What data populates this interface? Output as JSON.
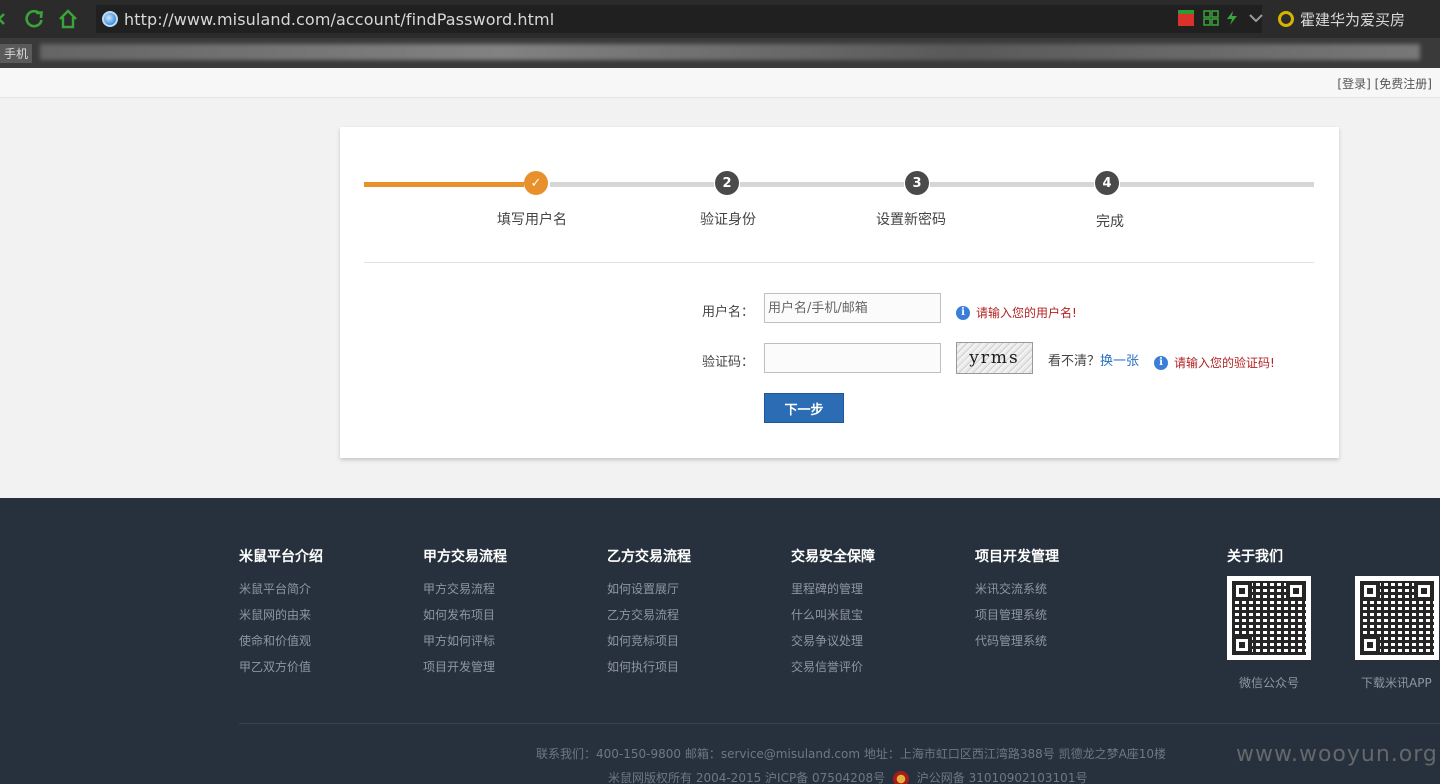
{
  "browser": {
    "url": "http://www.misuland.com/account/findPassword.html",
    "search_text": "霍建华为爱买房",
    "bookmark_label": "手机"
  },
  "topbar": {
    "login": "[登录]",
    "register": "[免费注册]"
  },
  "steps": [
    {
      "number": "✓",
      "label": "填写用户名",
      "state": "done"
    },
    {
      "number": "2",
      "label": "验证身份",
      "state": "pending"
    },
    {
      "number": "3",
      "label": "设置新密码",
      "state": "pending"
    },
    {
      "number": "4",
      "label": "完成",
      "state": "pending"
    }
  ],
  "form": {
    "username_label": "用户名：",
    "username_placeholder": "用户名/手机/邮箱",
    "username_value": "",
    "username_hint": "请输入您的用户名!",
    "captcha_label": "验证码：",
    "captcha_value": "",
    "captcha_text": "yrms",
    "refresh_prefix": "看不清？",
    "refresh_link": "换一张",
    "captcha_hint": "请输入您的验证码!",
    "next_button": "下一步"
  },
  "footer": {
    "columns": [
      {
        "title": "米鼠平台介绍",
        "items": [
          "米鼠平台简介",
          "米鼠网的由来",
          "使命和价值观",
          "甲乙双方价值"
        ]
      },
      {
        "title": "甲方交易流程",
        "items": [
          "甲方交易流程",
          "如何发布项目",
          "甲方如何评标",
          "项目开发管理"
        ]
      },
      {
        "title": "乙方交易流程",
        "items": [
          "如何设置展厅",
          "乙方交易流程",
          "如何竞标项目",
          "如何执行项目"
        ]
      },
      {
        "title": "交易安全保障",
        "items": [
          "里程碑的管理",
          "什么叫米鼠宝",
          "交易争议处理",
          "交易信誉评价"
        ]
      },
      {
        "title": "项目开发管理",
        "items": [
          "米讯交流系统",
          "项目管理系统",
          "代码管理系统"
        ]
      }
    ],
    "about_title": "关于我们",
    "qr1_caption": "微信公众号",
    "qr2_caption": "下载米讯APP",
    "contact_line": "联系我们：400-150-9800 邮箱：service@misuland.com 地址：上海市虹口区西江湾路388号 凯德龙之梦A座10楼",
    "copyright_prefix": "米鼠网版权所有 2004-2015 沪ICP备 07504208号",
    "copyright_suffix": "沪公网备 31010902103101号",
    "watermark": "www.wooyun.org"
  },
  "colors": {
    "accent_orange": "#e8902b",
    "button_blue": "#2b6cb5",
    "footer_bg": "#27313d",
    "hint_red": "#b22222"
  }
}
